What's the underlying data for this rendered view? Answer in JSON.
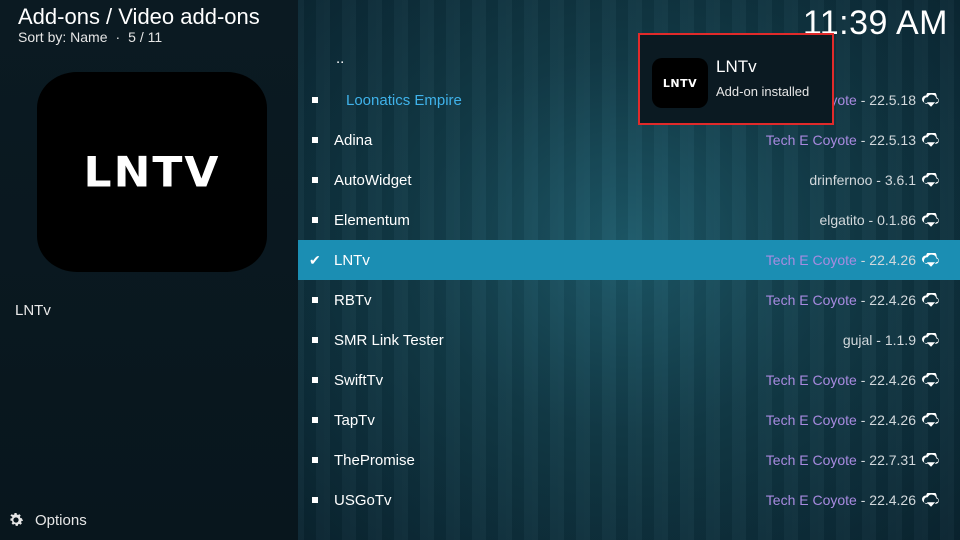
{
  "header": {
    "title": "Add-ons / Video add-ons",
    "sort_label": "Sort by: Name",
    "position": "5 / 11",
    "clock": "11:39 AM"
  },
  "preview": {
    "logo_text": "LNTV",
    "name": "LNTv"
  },
  "footer": {
    "options_label": "Options"
  },
  "list": {
    "parent": "..",
    "items": [
      {
        "name": "Loonatics Empire",
        "author": "Tech E Coyote",
        "version": "- 22.5.18",
        "installed": false
      },
      {
        "name": "Adina",
        "author": "Tech E Coyote",
        "version": "- 22.5.13",
        "installed": false
      },
      {
        "name": "AutoWidget",
        "author": "drinfernoo",
        "version": "- 3.6.1",
        "installed": false
      },
      {
        "name": "Elementum",
        "author": "elgatito",
        "version": "- 0.1.86",
        "installed": false
      },
      {
        "name": "LNTv",
        "author": "Tech E Coyote",
        "version": "- 22.4.26",
        "installed": true,
        "selected": true
      },
      {
        "name": "RBTv",
        "author": "Tech E Coyote",
        "version": "- 22.4.26",
        "installed": false
      },
      {
        "name": "SMR Link Tester",
        "author": "gujal",
        "version": "- 1.1.9",
        "installed": false
      },
      {
        "name": "SwiftTv",
        "author": "Tech E Coyote",
        "version": "- 22.4.26",
        "installed": false
      },
      {
        "name": "TapTv",
        "author": "Tech E Coyote",
        "version": "- 22.4.26",
        "installed": false
      },
      {
        "name": "ThePromise",
        "author": "Tech E Coyote",
        "version": "- 22.7.31",
        "installed": false
      },
      {
        "name": "USGoTv",
        "author": "Tech E Coyote",
        "version": "- 22.4.26",
        "installed": false
      }
    ]
  },
  "toast": {
    "icon_text": "LNTV",
    "title": "LNTv",
    "message": "Add-on installed",
    "border_color": "#e12a2a"
  },
  "colors": {
    "selected_row": "#1b8eb3",
    "highlight_name": "#3fb2ea"
  }
}
